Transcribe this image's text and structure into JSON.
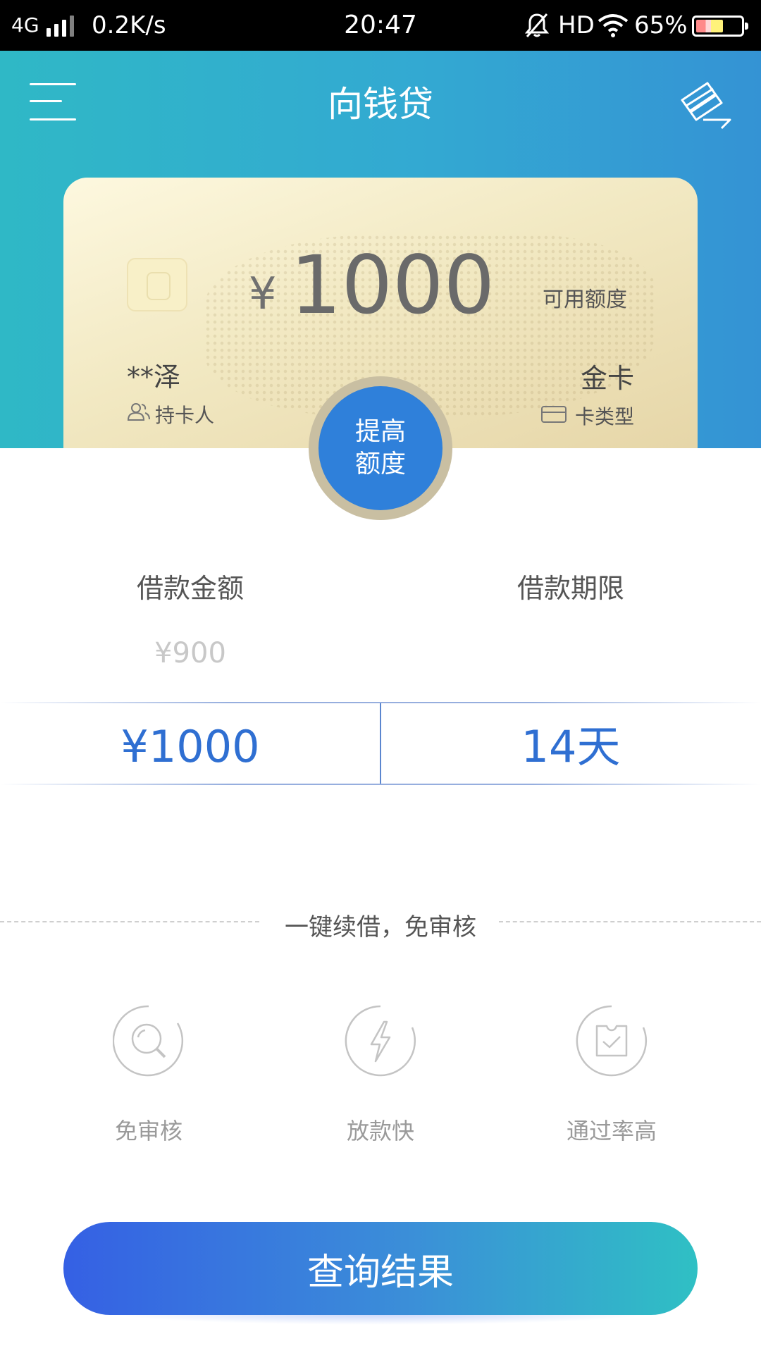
{
  "status_bar": {
    "network": "4G",
    "speed": "0.2K/s",
    "time": "20:47",
    "hd": "HD",
    "battery": "65%"
  },
  "header": {
    "title": "向钱贷",
    "menu_icon": "menu-icon",
    "right_icon": "credit-card-icon"
  },
  "card": {
    "currency": "¥",
    "amount": "1000",
    "available_label": "可用额度",
    "holder_name": "**泽",
    "holder_label": "持卡人",
    "card_type": "金卡",
    "card_type_label": "卡类型"
  },
  "raise_button": {
    "line1": "提高",
    "line2": "额度"
  },
  "loan": {
    "amount_label": "借款金额",
    "term_label": "借款期限",
    "amount_option_above": "¥900",
    "selected_amount": "¥1000",
    "selected_term": "14天"
  },
  "slogan": "一键续借，免审核",
  "features": [
    {
      "label": "免审核",
      "icon": "search-icon"
    },
    {
      "label": "放款快",
      "icon": "lightning-icon"
    },
    {
      "label": "通过率高",
      "icon": "check-ticket-icon"
    }
  ],
  "query_button": "查询结果",
  "colors": {
    "header_start": "#2fb8c6",
    "header_end": "#3493d4",
    "accent_blue": "#2f6fd2",
    "raise_button": "#2f80da",
    "button_start": "#3560e4",
    "button_end": "#2fc0c4"
  }
}
